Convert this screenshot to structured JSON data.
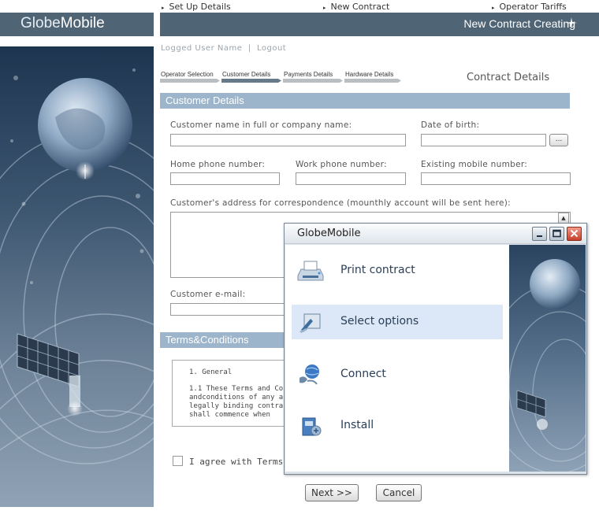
{
  "top_nav": {
    "items": [
      "Set Up Details",
      "New Contract",
      "Operator Tariffs"
    ]
  },
  "brand": {
    "light": "Globe",
    "bold": "Mobile"
  },
  "header": {
    "title": "New Contract Creating"
  },
  "user": {
    "name": "Logged User Name",
    "separator": "|",
    "logout": "Logout"
  },
  "steps": [
    {
      "label": "Operator Selection",
      "active": false
    },
    {
      "label": "Customer Details",
      "active": true
    },
    {
      "label": "Payments Details",
      "active": false
    },
    {
      "label": "Hardware Details",
      "active": false
    }
  ],
  "contract_details_title": "Contract Details",
  "customer_section": {
    "title": "Customer Details",
    "name_label": "Customer name in full or company name:",
    "dob_label": "Date of birth:",
    "dob_button": "...",
    "home_phone_label": "Home phone number:",
    "work_phone_label": "Work phone number:",
    "mobile_label": "Existing mobile number:",
    "address_label": "Customer's address for correspondence (mounthly account will be sent here):",
    "email_label": "Customer e-mail:"
  },
  "terms_section": {
    "title": "Terms&Conditions",
    "heading": "1. General",
    "lines": [
      "1.1 These Terms and Co",
      "andconditions of any ap",
      "legally binding contract",
      "shall commence  when"
    ],
    "agree_label": "I agree with Terms &"
  },
  "buttons": {
    "next": "Next >>",
    "cancel": "Cancel"
  },
  "dialog": {
    "title": "GlobeMobile",
    "items": [
      {
        "label": "Print contract",
        "icon": "printer-icon",
        "selected": false
      },
      {
        "label": "Select options",
        "icon": "options-icon",
        "selected": true
      },
      {
        "label": "Connect",
        "icon": "globe-connect-icon",
        "selected": false
      },
      {
        "label": "Install",
        "icon": "install-icon",
        "selected": false
      }
    ]
  },
  "colors": {
    "header_bar": "#4f6475",
    "section_bar": "#9db5cb",
    "selected_item": "#dce8f7",
    "close_button": "#c7402c"
  }
}
